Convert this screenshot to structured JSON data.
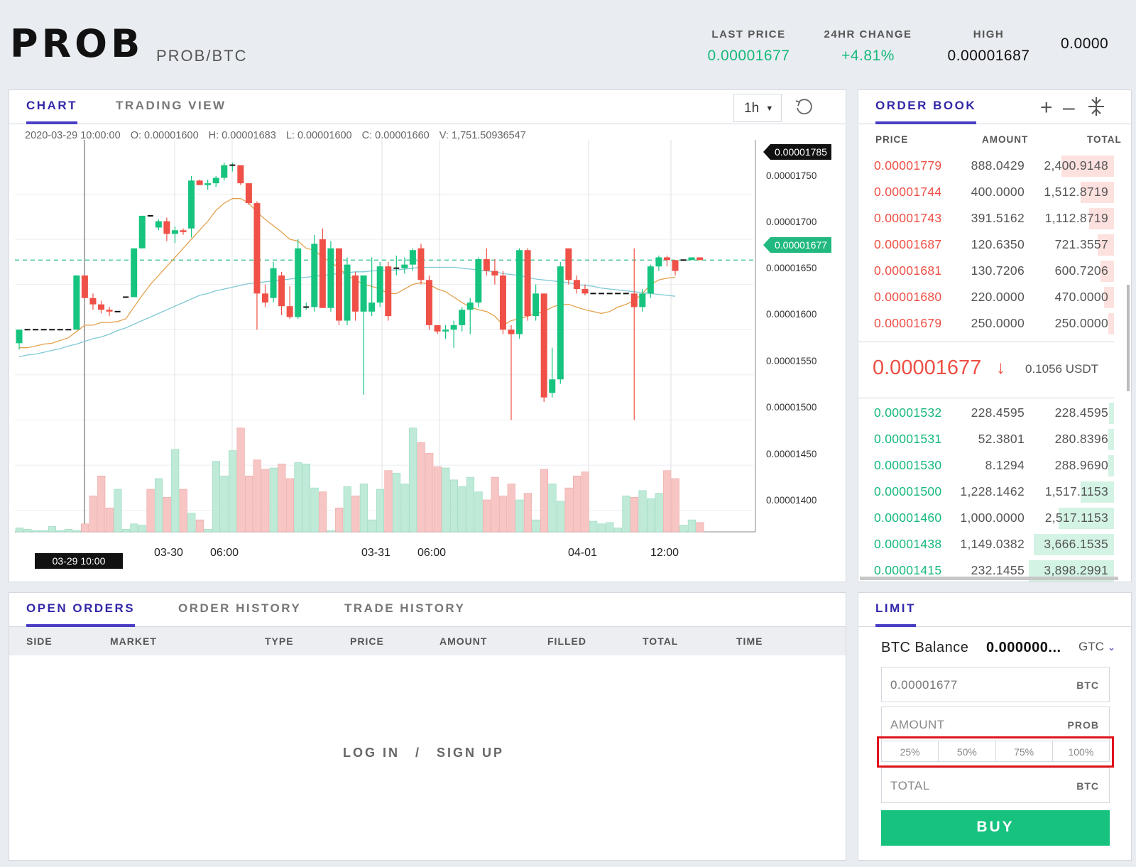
{
  "header": {
    "symbol": "PROB",
    "pair": "PROB/BTC",
    "stats": [
      {
        "label": "LAST PRICE",
        "value": "0.00001677",
        "color": "green"
      },
      {
        "label": "24HR CHANGE",
        "value": "+4.81%",
        "color": "green"
      },
      {
        "label": "HIGH",
        "value": "0.00001687",
        "color": "dark"
      },
      {
        "label": "",
        "value": "0.0000",
        "color": "dark"
      }
    ]
  },
  "chart_panel": {
    "tabs": [
      "CHART",
      "TRADING VIEW"
    ],
    "interval": "1h",
    "ohlc": {
      "time": "2020-03-29 10:00:00",
      "open": "O: 0.00001600",
      "high": "H: 0.00001683",
      "low": "L: 0.00001600",
      "close": "C: 0.00001660",
      "volume": "V: 1,751.50936547"
    },
    "price_ticks": [
      "0.00001750",
      "0.00001700",
      "0.00001650",
      "0.00001600",
      "0.00001550",
      "0.00001500",
      "0.00001450",
      "0.00001400"
    ],
    "time_ticks": [
      "03-30",
      "06:00",
      "03-31",
      "06:00",
      "04-01",
      "12:00"
    ],
    "crosshair_time_label": "03-29 10:00",
    "high_tag": "0.00001785",
    "last_tag": "0.00001677"
  },
  "chart_data": {
    "type": "candlestick",
    "interval": "1h",
    "ylim": [
      1.37e-05,
      1.81e-05
    ],
    "candles": [
      [
        1.585e-05,
        1.6e-05,
        1.578e-05,
        1.6e-05
      ],
      [
        1.6e-05,
        1.6e-05,
        1.6e-05,
        1.6e-05
      ],
      [
        1.6e-05,
        1.6e-05,
        1.6e-05,
        1.6e-05
      ],
      [
        1.6e-05,
        1.6e-05,
        1.6e-05,
        1.6e-05
      ],
      [
        1.6e-05,
        1.6e-05,
        1.6e-05,
        1.6e-05
      ],
      [
        1.6e-05,
        1.6e-05,
        1.6e-05,
        1.6e-05
      ],
      [
        1.6e-05,
        1.6e-05,
        1.6e-05,
        1.6e-05
      ],
      [
        1.6e-05,
        1.66e-05,
        1.6e-05,
        1.66e-05
      ],
      [
        1.66e-05,
        1.66e-05,
        1.635e-05,
        1.635e-05
      ],
      [
        1.635e-05,
        1.64e-05,
        1.622e-05,
        1.628e-05
      ],
      [
        1.628e-05,
        1.632e-05,
        1.618e-05,
        1.622e-05
      ],
      [
        1.622e-05,
        1.625e-05,
        1.615e-05,
        1.62e-05
      ],
      [
        1.62e-05,
        1.62e-05,
        1.62e-05,
        1.62e-05
      ],
      [
        1.636e-05,
        1.636e-05,
        1.636e-05,
        1.636e-05
      ],
      [
        1.636e-05,
        1.69e-05,
        1.636e-05,
        1.69e-05
      ],
      [
        1.69e-05,
        1.726e-05,
        1.69e-05,
        1.726e-05
      ],
      [
        1.726e-05,
        1.726e-05,
        1.725e-05,
        1.725e-05
      ],
      [
        1.713e-05,
        1.722e-05,
        1.71e-05,
        1.72e-05
      ],
      [
        1.72e-05,
        1.724e-05,
        1.698e-05,
        1.706e-05
      ],
      [
        1.706e-05,
        1.714e-05,
        1.696e-05,
        1.71e-05
      ],
      [
        1.71e-05,
        1.712e-05,
        1.705e-05,
        1.708e-05
      ],
      [
        1.712e-05,
        1.77e-05,
        1.702e-05,
        1.765e-05
      ],
      [
        1.765e-05,
        1.766e-05,
        1.76e-05,
        1.76e-05
      ],
      [
        1.76e-05,
        1.766e-05,
        1.755e-05,
        1.762e-05
      ],
      [
        1.762e-05,
        1.77e-05,
        1.758e-05,
        1.768e-05
      ],
      [
        1.768e-05,
        1.785e-05,
        1.765e-05,
        1.782e-05
      ],
      [
        1.782e-05,
        1.785e-05,
        1.775e-05,
        1.782e-05
      ],
      [
        1.782e-05,
        1.782e-05,
        1.76e-05,
        1.762e-05
      ],
      [
        1.762e-05,
        1.762e-05,
        1.738e-05,
        1.74e-05
      ],
      [
        1.74e-05,
        1.742e-05,
        1.6e-05,
        1.64e-05
      ],
      [
        1.64e-05,
        1.65e-05,
        1.625e-05,
        1.63e-05
      ],
      [
        1.635e-05,
        1.675e-05,
        1.63e-05,
        1.668e-05
      ],
      [
        1.66e-05,
        1.664e-05,
        1.616e-05,
        1.626e-05
      ],
      [
        1.626e-05,
        1.648e-05,
        1.612e-05,
        1.614e-05
      ],
      [
        1.614e-05,
        1.7e-05,
        1.612e-05,
        1.69e-05
      ],
      [
        1.625e-05,
        1.63e-05,
        1.622e-05,
        1.625e-05
      ],
      [
        1.625e-05,
        1.705e-05,
        1.62e-05,
        1.695e-05
      ],
      [
        1.7e-05,
        1.712e-05,
        1.624e-05,
        1.624e-05
      ],
      [
        1.624e-05,
        1.698e-05,
        1.62e-05,
        1.69e-05
      ],
      [
        1.69e-05,
        1.69e-05,
        1.605e-05,
        1.61e-05
      ],
      [
        1.61e-05,
        1.68e-05,
        1.605e-05,
        1.672e-05
      ],
      [
        1.66e-05,
        1.664e-05,
        1.61e-05,
        1.62e-05
      ],
      [
        1.62e-05,
        1.66e-05,
        1.528e-05,
        1.66e-05
      ],
      [
        1.62e-05,
        1.68e-05,
        1.615e-05,
        1.63e-05
      ],
      [
        1.63e-05,
        1.675e-05,
        1.625e-05,
        1.67e-05
      ],
      [
        1.67e-05,
        1.675e-05,
        1.61e-05,
        1.615e-05
      ],
      [
        1.668e-05,
        1.682e-05,
        1.66e-05,
        1.668e-05
      ],
      [
        1.668e-05,
        1.68e-05,
        1.662e-05,
        1.672e-05
      ],
      [
        1.672e-05,
        1.69e-05,
        1.665e-05,
        1.688e-05
      ],
      [
        1.69e-05,
        1.695e-05,
        1.65e-05,
        1.655e-05
      ],
      [
        1.655e-05,
        1.66e-05,
        1.6e-05,
        1.605e-05
      ],
      [
        1.605e-05,
        1.605e-05,
        1.595e-05,
        1.598e-05
      ],
      [
        1.598e-05,
        1.605e-05,
        1.59e-05,
        1.6e-05
      ],
      [
        1.6e-05,
        1.61e-05,
        1.58e-05,
        1.605e-05
      ],
      [
        1.605e-05,
        1.625e-05,
        1.598e-05,
        1.622e-05
      ],
      [
        1.622e-05,
        1.635e-05,
        1.595e-05,
        1.63e-05
      ],
      [
        1.63e-05,
        1.68e-05,
        1.625e-05,
        1.678e-05
      ],
      [
        1.678e-05,
        1.69e-05,
        1.66e-05,
        1.665e-05
      ],
      [
        1.665e-05,
        1.678e-05,
        1.65e-05,
        1.66e-05
      ],
      [
        1.66e-05,
        1.665e-05,
        1.595e-05,
        1.6e-05
      ],
      [
        1.6e-05,
        1.605e-05,
        1.5e-05,
        1.595e-05
      ],
      [
        1.595e-05,
        1.69e-05,
        1.59e-05,
        1.688e-05
      ],
      [
        1.688e-05,
        1.69e-05,
        1.61e-05,
        1.615e-05
      ],
      [
        1.615e-05,
        1.65e-05,
        1.61e-05,
        1.64e-05
      ],
      [
        1.64e-05,
        1.64e-05,
        1.52e-05,
        1.525e-05
      ],
      [
        1.53e-05,
        1.58e-05,
        1.525e-05,
        1.545e-05
      ],
      [
        1.545e-05,
        1.675e-05,
        1.54e-05,
        1.67e-05
      ],
      [
        1.69e-05,
        1.69e-05,
        1.65e-05,
        1.655e-05
      ],
      [
        1.655e-05,
        1.66e-05,
        1.64e-05,
        1.645e-05
      ],
      [
        1.645e-05,
        1.65e-05,
        1.638e-05,
        1.64e-05
      ],
      [
        1.64e-05,
        1.64e-05,
        1.64e-05,
        1.64e-05
      ],
      [
        1.64e-05,
        1.64e-05,
        1.64e-05,
        1.64e-05
      ],
      [
        1.64e-05,
        1.64e-05,
        1.64e-05,
        1.64e-05
      ],
      [
        1.64e-05,
        1.64e-05,
        1.64e-05,
        1.64e-05
      ],
      [
        1.64e-05,
        1.64e-05,
        1.64e-05,
        1.64e-05
      ],
      [
        1.64e-05,
        1.69e-05,
        1.5e-05,
        1.625e-05
      ],
      [
        1.625e-05,
        1.645e-05,
        1.62e-05,
        1.64e-05
      ],
      [
        1.64e-05,
        1.672e-05,
        1.635e-05,
        1.67e-05
      ],
      [
        1.67e-05,
        1.682e-05,
        1.665e-05,
        1.68e-05
      ],
      [
        1.68e-05,
        1.682e-05,
        1.67e-05,
        1.677e-05
      ],
      [
        1.677e-05,
        1.677e-05,
        1.66e-05,
        1.665e-05
      ],
      [
        1.677e-05,
        1.677e-05,
        1.677e-05,
        1.677e-05
      ],
      [
        1.677e-05,
        1.68e-05,
        1.677e-05,
        1.68e-05
      ],
      [
        1.68e-05,
        1.68e-05,
        1.677e-05,
        1.677e-05
      ]
    ],
    "volume_ylim": [
      0,
      8
    ],
    "volumes": [
      0.3,
      0.2,
      0.1,
      0.1,
      0.4,
      0.1,
      0.2,
      0.1,
      0.6,
      2.7,
      4.2,
      1.8,
      3.2,
      0.2,
      0.6,
      0.5,
      3.2,
      4.0,
      2.6,
      6.2,
      3.2,
      1.4,
      0.9,
      0.2,
      5.3,
      4.2,
      6.1,
      7.8,
      4.2,
      5.4,
      4.7,
      4.8,
      5.1,
      4.0,
      5.2,
      5.1,
      3.3,
      3.0,
      0.1,
      1.8,
      3.4,
      2.7,
      3.6,
      0.9,
      3.2,
      4.6,
      4.4,
      3.6,
      7.8,
      6.7,
      5.9,
      4.9,
      4.8,
      3.9,
      3.4,
      4.1,
      3.0,
      2.4,
      4.1,
      2.7,
      3.6,
      2.4,
      2.9,
      0.9,
      4.7,
      3.6,
      2.3,
      3.3,
      4.2,
      4.5,
      0.8,
      0.6,
      0.7,
      0.3,
      2.7,
      2.6,
      3.1,
      2.5,
      2.9,
      4.6,
      4.0,
      0.5,
      0.9,
      0.7
    ],
    "ma_short": [
      1.58e-05,
      1.58e-05,
      1.582e-05,
      1.584e-05,
      1.585e-05,
      1.588e-05,
      1.591e-05,
      1.598e-05,
      1.605e-05,
      1.605e-05,
      1.608e-05,
      1.608e-05,
      1.609e-05,
      1.612e-05,
      1.625e-05,
      1.638e-05,
      1.65e-05,
      1.66e-05,
      1.67e-05,
      1.68e-05,
      1.69e-05,
      1.7e-05,
      1.71e-05,
      1.72e-05,
      1.732e-05,
      1.74e-05,
      1.745e-05,
      1.745e-05,
      1.74e-05,
      1.73e-05,
      1.722e-05,
      1.715e-05,
      1.708e-05,
      1.7e-05,
      1.698e-05,
      1.69e-05,
      1.688e-05,
      1.68e-05,
      1.675e-05,
      1.668e-05,
      1.66e-05,
      1.655e-05,
      1.65e-05,
      1.648e-05,
      1.645e-05,
      1.64e-05,
      1.64e-05,
      1.645e-05,
      1.65e-05,
      1.652e-05,
      1.65e-05,
      1.645e-05,
      1.642e-05,
      1.636e-05,
      1.63e-05,
      1.625e-05,
      1.622e-05,
      1.62e-05,
      1.615e-05,
      1.605e-05,
      1.61e-05,
      1.612e-05,
      1.615e-05,
      1.618e-05,
      1.62e-05,
      1.625e-05,
      1.628e-05,
      1.628e-05,
      1.625e-05,
      1.622e-05,
      1.62e-05,
      1.618e-05,
      1.62e-05,
      1.625e-05,
      1.628e-05,
      1.632e-05,
      1.64e-05,
      1.65e-05,
      1.655e-05,
      1.657e-05,
      1.658e-05
    ],
    "ma_long": [
      1.57e-05,
      1.572e-05,
      1.573e-05,
      1.575e-05,
      1.577e-05,
      1.579e-05,
      1.582e-05,
      1.584e-05,
      1.587e-05,
      1.59e-05,
      1.592e-05,
      1.595e-05,
      1.599e-05,
      1.602e-05,
      1.606e-05,
      1.61e-05,
      1.614e-05,
      1.618e-05,
      1.622e-05,
      1.626e-05,
      1.63e-05,
      1.634e-05,
      1.638e-05,
      1.64e-05,
      1.643e-05,
      1.645e-05,
      1.647e-05,
      1.649e-05,
      1.651e-05,
      1.652e-05,
      1.653e-05,
      1.654e-05,
      1.655e-05,
      1.656e-05,
      1.657e-05,
      1.658e-05,
      1.659e-05,
      1.66e-05,
      1.661e-05,
      1.662e-05,
      1.663e-05,
      1.664e-05,
      1.664e-05,
      1.665e-05,
      1.665e-05,
      1.666e-05,
      1.666e-05,
      1.667e-05,
      1.668e-05,
      1.669e-05,
      1.669e-05,
      1.669e-05,
      1.669e-05,
      1.669e-05,
      1.668e-05,
      1.667e-05,
      1.666e-05,
      1.665e-05,
      1.664e-05,
      1.662e-05,
      1.661e-05,
      1.66e-05,
      1.658e-05,
      1.656e-05,
      1.655e-05,
      1.654e-05,
      1.653e-05,
      1.652e-05,
      1.65e-05,
      1.649e-05,
      1.648e-05,
      1.646e-05,
      1.645e-05,
      1.644e-05,
      1.643e-05,
      1.642e-05,
      1.641e-05,
      1.64e-05,
      1.639e-05,
      1.638e-05,
      1.637e-05
    ]
  },
  "order_book": {
    "title": "ORDER BOOK",
    "columns": [
      "PRICE",
      "AMOUNT",
      "TOTAL"
    ],
    "asks": [
      {
        "price": "0.00001779",
        "amount": "888.0429",
        "total": "2,400.9148",
        "depth": 0.62
      },
      {
        "price": "0.00001744",
        "amount": "400.0000",
        "total": "1,512.8719",
        "depth": 0.39
      },
      {
        "price": "0.00001743",
        "amount": "391.5162",
        "total": "1,112.8719",
        "depth": 0.29
      },
      {
        "price": "0.00001687",
        "amount": "120.6350",
        "total": "721.3557",
        "depth": 0.19
      },
      {
        "price": "0.00001681",
        "amount": "130.7206",
        "total": "600.7206",
        "depth": 0.16
      },
      {
        "price": "0.00001680",
        "amount": "220.0000",
        "total": "470.0000",
        "depth": 0.12
      },
      {
        "price": "0.00001679",
        "amount": "250.0000",
        "total": "250.0000",
        "depth": 0.07
      }
    ],
    "mid": {
      "price": "0.00001677",
      "arrow": "↓",
      "usdt": "0.1056 USDT"
    },
    "bids": [
      {
        "price": "0.00001532",
        "amount": "228.4595",
        "total": "228.4595",
        "depth": 0.06
      },
      {
        "price": "0.00001531",
        "amount": "52.3801",
        "total": "280.8396",
        "depth": 0.07
      },
      {
        "price": "0.00001530",
        "amount": "8.1294",
        "total": "288.9690",
        "depth": 0.07
      },
      {
        "price": "0.00001500",
        "amount": "1,228.1462",
        "total": "1,517.1153",
        "depth": 0.39
      },
      {
        "price": "0.00001460",
        "amount": "1,000.0000",
        "total": "2,517.1153",
        "depth": 0.65
      },
      {
        "price": "0.00001438",
        "amount": "1,149.0382",
        "total": "3,666.1535",
        "depth": 0.94
      },
      {
        "price": "0.00001415",
        "amount": "232.1455",
        "total": "3,898.2991",
        "depth": 1.0
      }
    ]
  },
  "orders_panel": {
    "tabs": [
      "OPEN ORDERS",
      "ORDER HISTORY",
      "TRADE HISTORY"
    ],
    "columns": [
      "SIDE",
      "MARKET",
      "TYPE",
      "PRICE",
      "AMOUNT",
      "FILLED",
      "TOTAL",
      "TIME"
    ],
    "login": "LOG IN",
    "sep": "/",
    "signup": "SIGN UP"
  },
  "order_form": {
    "tab": "LIMIT",
    "balance_label": "BTC Balance",
    "balance_value": "0.000000...",
    "tif": "GTC",
    "price_value": "0.00001677",
    "price_unit": "BTC",
    "amount_placeholder": "AMOUNT",
    "amount_unit": "PROB",
    "percents": [
      "25%",
      "50%",
      "75%",
      "100%"
    ],
    "total_placeholder": "TOTAL",
    "total_unit": "BTC",
    "buy_label": "BUY"
  },
  "colors": {
    "accent": "#4a3ec5",
    "up": "#16c47f",
    "down": "#ef5047",
    "highlight": "#e0141b"
  }
}
